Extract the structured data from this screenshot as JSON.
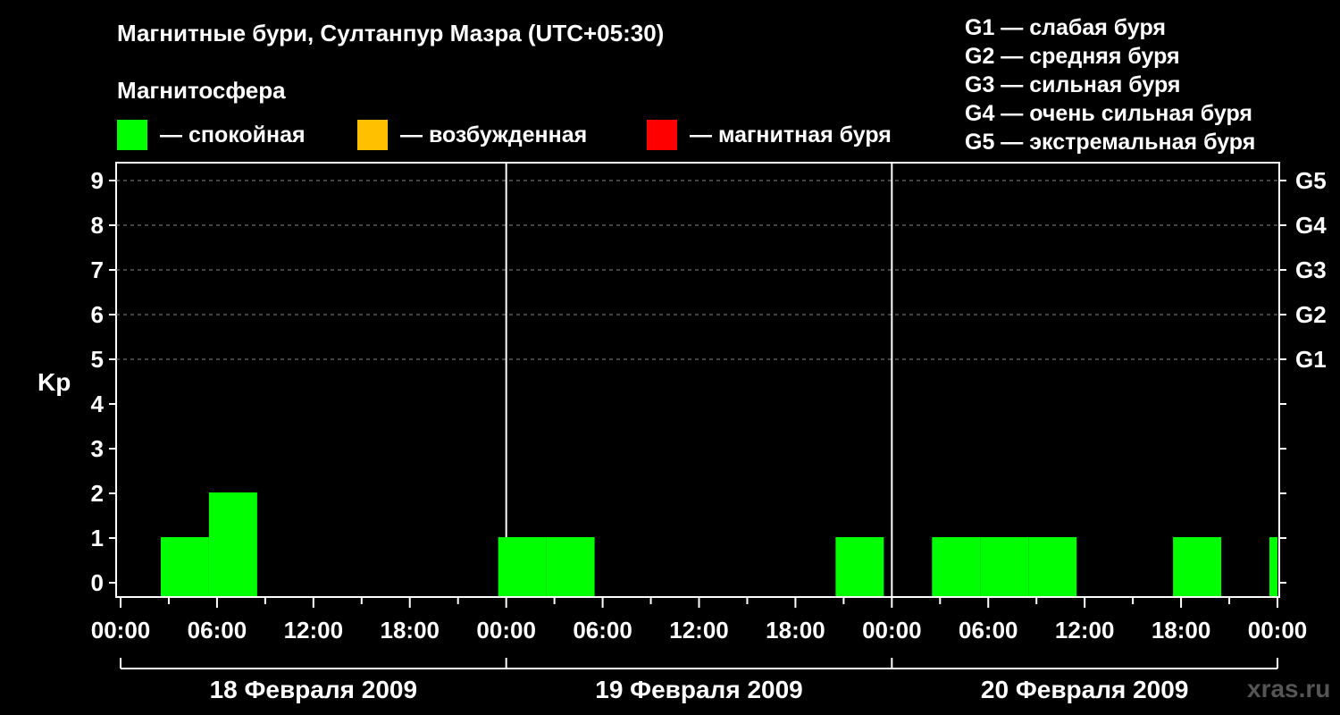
{
  "header": {
    "title": "Магнитные бури, Султанпур Мазра (UTC+05:30)",
    "subtitle": "Магнитосфера"
  },
  "legend": [
    {
      "label": "— спокойная",
      "color": "#00ff00"
    },
    {
      "label": "— возбужденная",
      "color": "#ffc000"
    },
    {
      "label": "— магнитная буря",
      "color": "#ff0000"
    }
  ],
  "g_scale": [
    "G1 — слабая буря",
    "G2 — средняя буря",
    "G3 — сильная буря",
    "G4 — очень сильная буря",
    "G5 — экстремальная буря"
  ],
  "watermark": "xras.ru",
  "chart_data": {
    "type": "bar",
    "ylabel": "Kp",
    "ylim": [
      0,
      9
    ],
    "yticks": [
      "0",
      "1",
      "2",
      "3",
      "4",
      "5",
      "6",
      "7",
      "8",
      "9"
    ],
    "right_ticks": [
      {
        "kp": 5,
        "label": "G1"
      },
      {
        "kp": 6,
        "label": "G2"
      },
      {
        "kp": 7,
        "label": "G3"
      },
      {
        "kp": 8,
        "label": "G4"
      },
      {
        "kp": 9,
        "label": "G5"
      }
    ],
    "grid": "dashed horizontal at Kp 5–9",
    "xtick_labels": [
      "00:00",
      "06:00",
      "12:00",
      "18:00",
      "00:00",
      "06:00",
      "12:00",
      "18:00",
      "00:00",
      "06:00",
      "12:00",
      "18:00",
      "00:00"
    ],
    "days": [
      "18 Февраля 2009",
      "19 Февраля 2009",
      "20 Февраля 2009"
    ],
    "bar_hours": 3,
    "series": [
      {
        "day_index": [
          0,
          0,
          1,
          1,
          1,
          2,
          2,
          2,
          2,
          2
        ],
        "start_hour": [
          2.5,
          5.5,
          23.5,
          26.5,
          44.5,
          50.5,
          53.5,
          56.5,
          65.5,
          71.5
        ],
        "duration_hours": [
          3,
          3,
          3,
          3,
          3,
          3,
          3,
          3,
          3,
          0.5
        ],
        "values": [
          1,
          2,
          1,
          1,
          1,
          1,
          1,
          1,
          1,
          1
        ],
        "level": [
          "quiet",
          "quiet",
          "quiet",
          "quiet",
          "quiet",
          "quiet",
          "quiet",
          "quiet",
          "quiet",
          "quiet"
        ]
      }
    ],
    "colors": {
      "quiet": "#00ff00",
      "active": "#ffc000",
      "storm": "#ff0000"
    }
  }
}
